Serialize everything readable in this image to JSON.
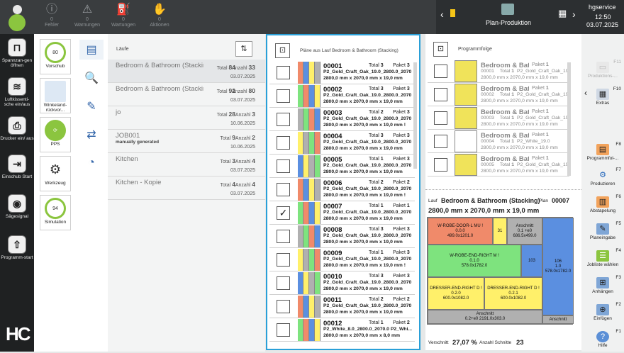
{
  "topbar": {
    "alerts": [
      {
        "label": "Fehler",
        "count": "0"
      },
      {
        "label": "Warnungen",
        "count": "0"
      },
      {
        "label": "Wartungen",
        "count": "0"
      },
      {
        "label": "Aktionen",
        "count": "0"
      }
    ],
    "screen_title": "Plan-Produktion",
    "user": "hgservice",
    "time": "12:50",
    "date": "03.07.2025"
  },
  "leftrail": [
    {
      "label": "Spannzan-gen öffnen",
      "icon": "clamp-icon"
    },
    {
      "label": "Luftkissenti-sche ein/aus",
      "icon": "air-table-icon"
    },
    {
      "label": "Drucker ein/ aus",
      "icon": "printer-icon"
    },
    {
      "label": "Einschub Start",
      "icon": "infeed-icon"
    },
    {
      "label": "Sägesignal",
      "icon": "saw-signal-icon"
    },
    {
      "label": "Programm-start",
      "icon": "program-start-icon"
    }
  ],
  "modules": [
    {
      "label": "Vorschub",
      "value": "80"
    },
    {
      "label": "Winkeland-rückvor...",
      "value": ""
    },
    {
      "label": "PPS",
      "value": ""
    },
    {
      "label": "Werkzeug",
      "value": ""
    },
    {
      "label": "Simulation",
      "value": "94"
    }
  ],
  "laeufe": {
    "header": "Läufe",
    "rows": [
      {
        "name": "Bedroom & Bathroom (Stacking)",
        "total_label": "Total",
        "total": "84",
        "anz_label": "Anzahl",
        "anz": "33",
        "date": "03.07.2025",
        "sub": ""
      },
      {
        "name": "Bedroom & Bathroom (Stacking)",
        "total_label": "Total",
        "total": "92",
        "anz_label": "Anzahl",
        "anz": "80",
        "date": "03.07.2025",
        "sub": ""
      },
      {
        "name": "jo",
        "total_label": "Total",
        "total": "28",
        "anz_label": "Anzahl",
        "anz": "3",
        "date": "10.06.2025",
        "sub": ""
      },
      {
        "name": "JOB001",
        "total_label": "Total",
        "total": "9",
        "anz_label": "Anzahl",
        "anz": "2",
        "date": "10.06.2025",
        "sub": "manually generated"
      },
      {
        "name": "Kitchen",
        "total_label": "Total",
        "total": "3",
        "anz_label": "Anzahl",
        "anz": "4",
        "date": "03.07.2025",
        "sub": ""
      },
      {
        "name": "Kitchen - Kopie",
        "total_label": "Total",
        "total": "4",
        "anz_label": "Anzahl",
        "anz": "4",
        "date": "03.07.2025",
        "sub": ""
      }
    ]
  },
  "plaene": {
    "header": "Pläne aus Lauf Bedroom & Bathroom (Stacking)",
    "rows": [
      {
        "no": "00001",
        "total": "3",
        "paket": "3",
        "l2": "P2_Gold_Craft_Oak_19.0_2800.0_2070",
        "l3": "2800,0 mm x 2070,0 mm x 19,0 mm",
        "checked": ""
      },
      {
        "no": "00002",
        "total": "3",
        "paket": "3",
        "l2": "P2_Gold_Craft_Oak_19.0_2800.0_2070",
        "l3": "2800,0 mm x 2070,0 mm x 19,0 mm",
        "checked": ""
      },
      {
        "no": "00003",
        "total": "2",
        "paket": "3",
        "l2": "P2_Gold_Craft_Oak_19.0_2800.0_2070",
        "l3": "2800,0 mm x 2070,0 mm x 19,0 mm !",
        "checked": ""
      },
      {
        "no": "00004",
        "total": "3",
        "paket": "3",
        "l2": "P2_Gold_Craft_Oak_19.0_2800.0_2070",
        "l3": "2800,0 mm x 2070,0 mm x 19,0 mm",
        "checked": ""
      },
      {
        "no": "00005",
        "total": "1",
        "paket": "3",
        "l2": "P2_Gold_Craft_Oak_19.0_2800.0_2070",
        "l3": "2800,0 mm x 2070,0 mm x 19,0 mm",
        "checked": ""
      },
      {
        "no": "00006",
        "total": "2",
        "paket": "2",
        "l2": "P2_Gold_Craft_Oak_19.0_2800.0_2070",
        "l3": "2800,0 mm x 2070,0 mm x 19,0 mm !",
        "checked": ""
      },
      {
        "no": "00007",
        "total": "1",
        "paket": "1",
        "l2": "P2_Gold_Craft_Oak_19.0_2800.0_2070",
        "l3": "2800,0 mm x 2070,0 mm x 19,0 mm",
        "checked": "✓"
      },
      {
        "no": "00008",
        "total": "3",
        "paket": "3",
        "l2": "P2_Gold_Craft_Oak_19.0_2800.0_2070",
        "l3": "2800,0 mm x 2070,0 mm x 19,0 mm",
        "checked": ""
      },
      {
        "no": "00009",
        "total": "1",
        "paket": "3",
        "l2": "P2_Gold_Craft_Oak_19.0_2800.0_2070",
        "l3": "2800,0 mm x 2070,0 mm x 19,0 mm !",
        "checked": ""
      },
      {
        "no": "00010",
        "total": "3",
        "paket": "3",
        "l2": "P2_Gold_Craft_Oak_19.0_2800.0_2070",
        "l3": "2800,0 mm x 2070,0 mm x 19,0 mm",
        "checked": ""
      },
      {
        "no": "00011",
        "total": "2",
        "paket": "2",
        "l2": "P2_Gold_Craft_Oak_19.0_2800.0_2070",
        "l3": "2800,0 mm x 2070,0 mm x 19,0 mm",
        "checked": ""
      },
      {
        "no": "00012",
        "total": "1",
        "paket": "2",
        "l2": "P2_White_8.0_2800.0_2070.0 P2_Whi...",
        "l3": "2800,0 mm x 2070,0 mm x 8,0 mm",
        "checked": ""
      }
    ]
  },
  "programmfolge": {
    "header": "Programmfolge",
    "rows": [
      {
        "name": "Bedroom & Bat...",
        "paket": "1",
        "id": "00001",
        "l2": "P2_Gold_Craft_Oak_19.0",
        "l3": "2800,0 mm x 2070,0 mm x 19,0 mm"
      },
      {
        "name": "Bedroom & Bat...",
        "paket": "1",
        "id": "00002",
        "l2": "P2_Gold_Craft_Oak_19.0",
        "l3": "2800,0 mm x 2070,0 mm x 19,0 mm"
      },
      {
        "name": "Bedroom & Bat...",
        "paket": "1",
        "id": "00003",
        "l2": "P2_Gold_Craft_Oak_19.0",
        "l3": "2800,0 mm x 2070,0 mm x 19,0 mm"
      },
      {
        "name": "Bedroom & Bat...",
        "paket": "1",
        "id": "00004",
        "l2": "P2_White_19.0",
        "l3": "2800,0 mm x 2070,0 mm x 19,0 mm"
      },
      {
        "name": "Bedroom & Bat...",
        "paket": "1",
        "id": "00005",
        "l2": "P2_Gold_Craft_Oak_19.0",
        "l3": "2800,0 mm x 2070,0 mm x 19,0 mm"
      }
    ],
    "total_label": "Total",
    "paket_label": "Paket",
    "lauf_label": "Lauf",
    "lauf_name": "Bedroom & Bathroom (Stacking)",
    "plan_label": "Plan",
    "plan_no": "00007",
    "dims": "2800,0 mm x 2070,0 mm x 19,0 mm",
    "verschnitt_label": "Verschnitt",
    "verschnitt": "27,07 %",
    "schnitte_label": "Anzahl Schnitte",
    "schnitte": "23",
    "parts": [
      {
        "name": "W-ROBE-DOOR-L MU !",
        "id": "0.0.0",
        "dim": "499.0x1201.0"
      },
      {
        "name": "31",
        "id": "",
        "dim": ""
      },
      {
        "name": "Anschnitt",
        "id": "0.1 +e0",
        "dim": "686.5x499.0"
      },
      {
        "name": "W-ROBE-END-RIGHT M !",
        "id": "0.1.0",
        "dim": "578.0x1782.0"
      },
      {
        "name": "103",
        "id": "",
        "dim": ""
      },
      {
        "name": "106",
        "id": "1.0",
        "dim": "578.0x1782.0"
      },
      {
        "name": "DRESSER-END-RIGHT D !",
        "id": "0.2.0",
        "dim": "600.0x1082.0"
      },
      {
        "name": "DRESSER-END-RIGHT D !",
        "id": "0.2.1",
        "dim": "600.0x1082.0"
      },
      {
        "name": "Anschnitt",
        "id": "0.2+e0 2191.0x303.0",
        "dim": ""
      },
      {
        "name": "Anschnitt",
        "id": "",
        "dim": ""
      }
    ]
  },
  "fkeys": [
    {
      "key": "F11",
      "label": "Produktions-..."
    },
    {
      "key": "F10",
      "label": "Extras"
    },
    {
      "key": "F8",
      "label": "Programmfol-..."
    },
    {
      "key": "F7",
      "label": "Produzieren"
    },
    {
      "key": "F6",
      "label": "Abstapelung"
    },
    {
      "key": "F5",
      "label": "Planeingabe"
    },
    {
      "key": "F4",
      "label": "Jobliste wählen"
    },
    {
      "key": "F3",
      "label": "Anhängen"
    },
    {
      "key": "F2",
      "label": "Einfügen"
    },
    {
      "key": "F1",
      "label": "Hilfe"
    }
  ],
  "common": {
    "total": "Total",
    "paket": "Paket",
    "anzahl": "Anzahl"
  },
  "logo": "HC",
  "colors": {
    "accent": "#2aa0d8",
    "status_green": "#8bc53f",
    "topbar": "#3a3d3f",
    "cut_orange": "#f08a6a",
    "cut_green": "#7ee37e",
    "cut_yellow": "#fff06a",
    "cut_blue": "#5b8fe0",
    "cut_gray": "#b0b0b0"
  }
}
